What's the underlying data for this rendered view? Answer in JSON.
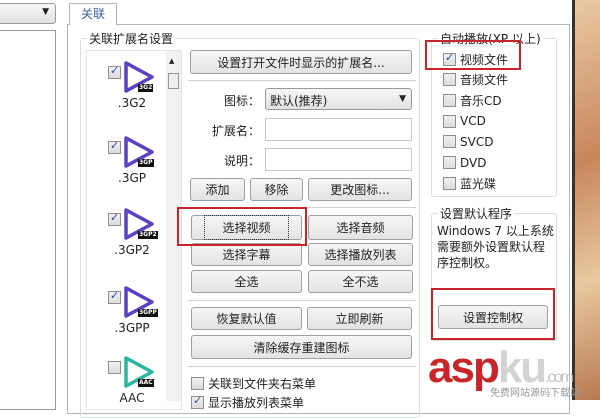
{
  "left_panel": {
    "dropdown_value": ""
  },
  "tabs": [
    {
      "label": "关联"
    }
  ],
  "assoc_group": {
    "title": "关联扩展名设置",
    "extensions": [
      {
        "name": ".3G2",
        "badge": "3G2",
        "checked": true,
        "color": "#5b3fc4"
      },
      {
        "name": ".3GP",
        "badge": "3GP",
        "checked": true,
        "color": "#5b3fc4"
      },
      {
        "name": ".3GP2",
        "badge": "3GP2",
        "checked": true,
        "color": "#5b3fc4"
      },
      {
        "name": ".3GPP",
        "badge": "3GPP",
        "checked": true,
        "color": "#5b3fc4"
      },
      {
        "name": "AAC",
        "badge": "AAC",
        "checked": false,
        "color": "#2ab7a0"
      }
    ],
    "set_ext_button": "设置打开文件时显示的扩展名...",
    "icon_label": "图标：",
    "icon_select": "默认(推荐)",
    "ext_label": "扩展名：",
    "desc_label": "说明：",
    "add": "添加",
    "remove": "移除",
    "change_icon": "更改图标...",
    "select_video": "选择视频",
    "select_audio": "选择音频",
    "select_subtitle": "选择字幕",
    "select_playlist": "选择播放列表",
    "select_all": "全选",
    "select_none": "全不选",
    "restore_defaults": "恢复默认值",
    "refresh_now": "立即刷新",
    "clear_cache": "清除缓存重建图标",
    "folder_menu": "关联到文件夹右菜单",
    "playlist_menu": "显示播放列表菜单"
  },
  "autoplay_group": {
    "title": "自动播放(XP 以上)",
    "items": [
      {
        "label": "视频文件",
        "checked": true
      },
      {
        "label": "音频文件",
        "checked": false
      },
      {
        "label": "音乐CD",
        "checked": false
      },
      {
        "label": "VCD",
        "checked": false
      },
      {
        "label": "SVCD",
        "checked": false
      },
      {
        "label": "DVD",
        "checked": false
      },
      {
        "label": "蓝光碟",
        "checked": false
      }
    ]
  },
  "default_group": {
    "title": "设置默认程序",
    "text": "Windows 7 以上系统需要额外设置默认程序控制权。",
    "button": "设置控制权"
  },
  "watermark": {
    "brand": "aspku.com",
    "sub": "免费网站源码下载站!"
  },
  "colors": {
    "highlight": "#c8252b"
  }
}
